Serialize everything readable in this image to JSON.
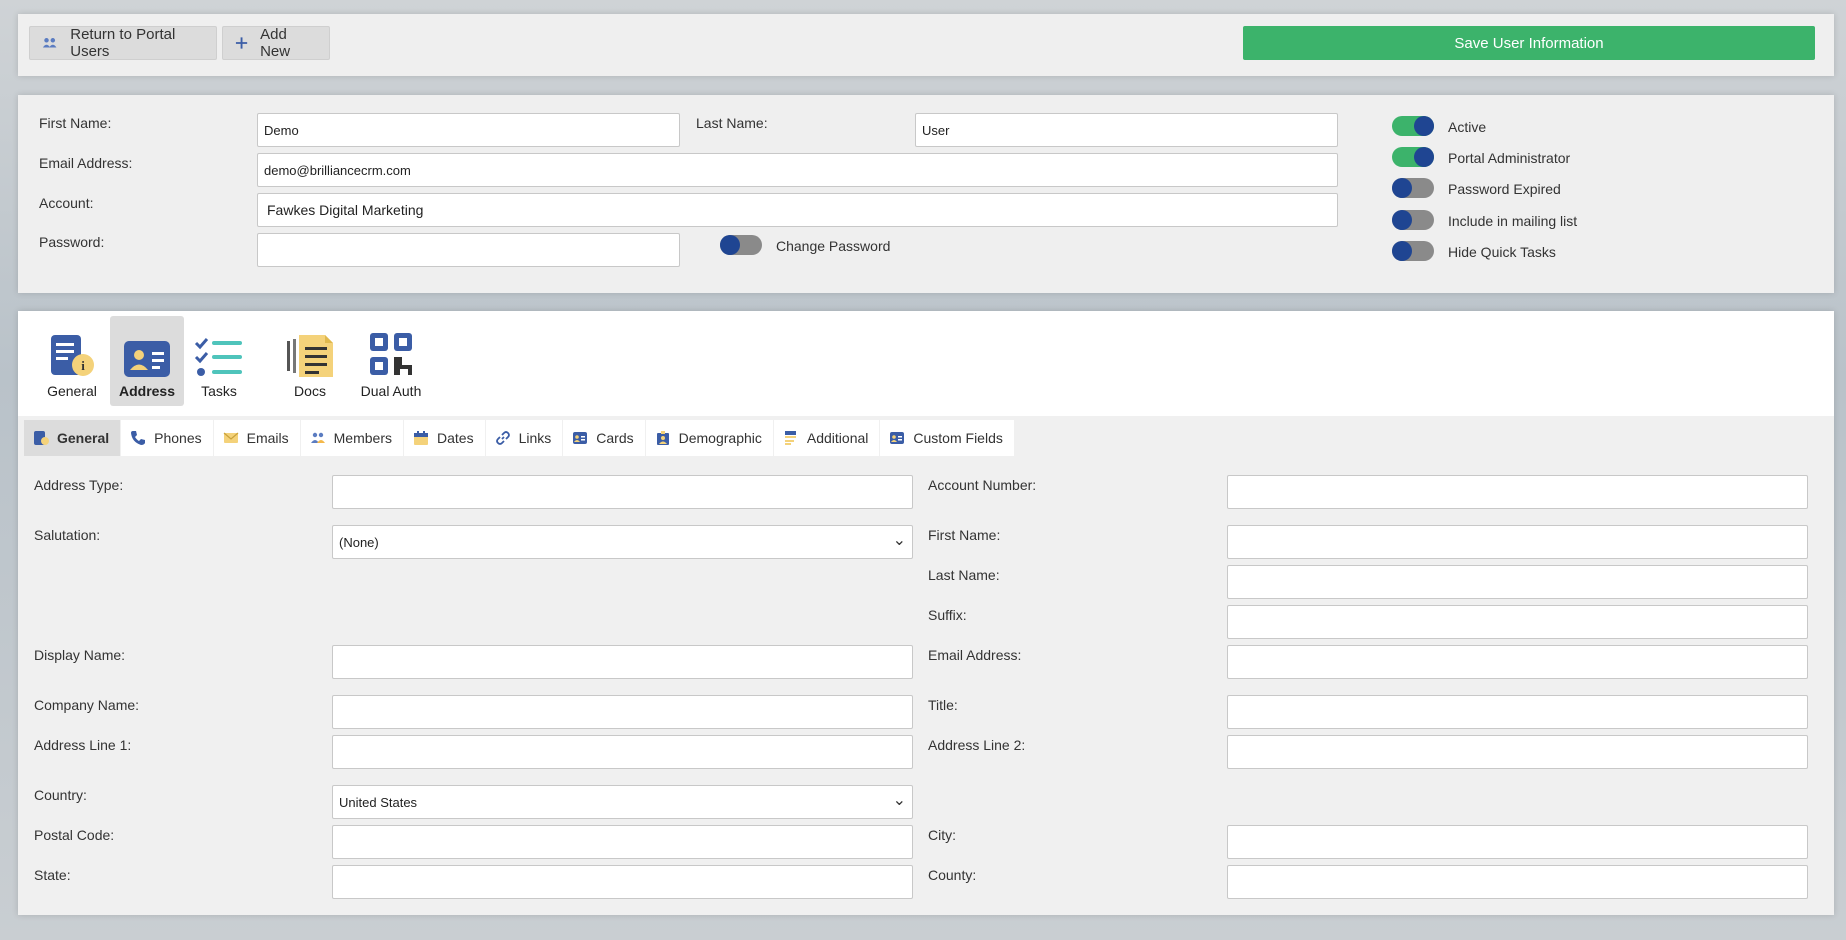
{
  "toolbar": {
    "return_label": "Return to Portal Users",
    "add_label": "Add New",
    "save_label": "Save User Information"
  },
  "user": {
    "first_name_label": "First Name:",
    "first_name": "Demo",
    "last_name_label": "Last Name:",
    "last_name": "User",
    "email_label": "Email Address:",
    "email": "demo@brilliancecrm.com",
    "account_label": "Account:",
    "account": "Fawkes Digital Marketing",
    "password_label": "Password:",
    "password": "",
    "change_password_label": "Change Password",
    "change_password_on": false
  },
  "flags": [
    {
      "label": "Active",
      "on": true
    },
    {
      "label": "Portal Administrator",
      "on": true
    },
    {
      "label": "Password Expired",
      "on": false
    },
    {
      "label": "Include in mailing list",
      "on": false
    },
    {
      "label": "Hide Quick Tasks",
      "on": false
    }
  ],
  "icon_tabs": [
    {
      "label": "General",
      "icon": "general-info-icon"
    },
    {
      "label": "Address",
      "icon": "address-card-icon",
      "active": true
    },
    {
      "label": "Tasks",
      "icon": "tasks-checklist-icon"
    },
    {
      "label": "Docs",
      "icon": "docs-icon"
    },
    {
      "label": "Dual Auth",
      "icon": "qr-code-icon"
    }
  ],
  "sub_tabs": [
    {
      "label": "General",
      "icon": "general-icon",
      "active": true
    },
    {
      "label": "Phones",
      "icon": "phone-icon"
    },
    {
      "label": "Emails",
      "icon": "envelope-icon"
    },
    {
      "label": "Members",
      "icon": "members-icon"
    },
    {
      "label": "Dates",
      "icon": "calendar-icon"
    },
    {
      "label": "Links",
      "icon": "link-icon"
    },
    {
      "label": "Cards",
      "icon": "card-icon"
    },
    {
      "label": "Demographic",
      "icon": "demographic-icon"
    },
    {
      "label": "Additional",
      "icon": "additional-icon"
    },
    {
      "label": "Custom Fields",
      "icon": "custom-fields-icon"
    }
  ],
  "address": {
    "address_type_label": "Address Type:",
    "account_number_label": "Account Number:",
    "salutation_label": "Salutation:",
    "salutation_value": "(None)",
    "first_name_label": "First Name:",
    "last_name_label": "Last Name:",
    "suffix_label": "Suffix:",
    "display_name_label": "Display Name:",
    "email_label": "Email Address:",
    "company_label": "Company Name:",
    "title_label": "Title:",
    "line1_label": "Address Line 1:",
    "line2_label": "Address Line 2:",
    "country_label": "Country:",
    "country_value": "United States",
    "postal_label": "Postal Code:",
    "city_label": "City:",
    "state_label": "State:",
    "county_label": "County:"
  },
  "colors": {
    "accent_green": "#3cb36b",
    "toggle_knob": "#1f4592",
    "icon_blue": "#3b5da6",
    "icon_yellow": "#f4d27a",
    "icon_teal": "#4fc4bb"
  }
}
